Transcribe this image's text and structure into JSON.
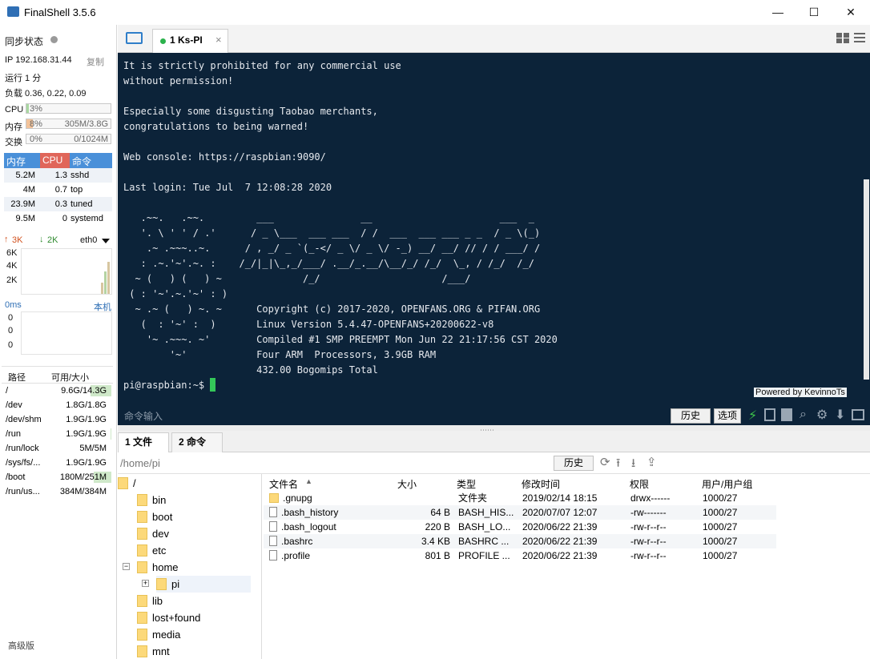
{
  "window": {
    "title": "FinalShell 3.5.6",
    "controls": {
      "minimize": "—",
      "maximize": "☐",
      "close": "✕"
    }
  },
  "left_panel": {
    "sync_label": "同步状态",
    "ip_label": "IP 192.168.31.44",
    "copy_label": "复制",
    "uptime": "运行 1 分",
    "load": "负载 0.36, 0.22, 0.09",
    "cpu": {
      "label": "CPU",
      "percent_text": "3%",
      "fraction": 0.03
    },
    "mem": {
      "label": "内存",
      "percent_text": "8%",
      "detail": "305M/3.8G",
      "fraction": 0.08
    },
    "swap": {
      "label": "交换",
      "percent_text": "0%",
      "detail": "0/1024M",
      "fraction": 0.0
    },
    "proc_headers": {
      "mem": "内存",
      "cpu": "CPU",
      "cmd": "命令"
    },
    "processes": [
      {
        "mem": "5.2M",
        "cpu": "1.3",
        "cmd": "sshd"
      },
      {
        "mem": "4M",
        "cpu": "0.7",
        "cmd": "top"
      },
      {
        "mem": "23.9M",
        "cpu": "0.3",
        "cmd": "tuned"
      },
      {
        "mem": "9.5M",
        "cpu": "0",
        "cmd": "systemd"
      }
    ],
    "net": {
      "up": "3K",
      "down": "2K",
      "iface": "eth0",
      "scale": [
        "6K",
        "4K",
        "2K"
      ]
    },
    "ping": {
      "label": "0ms",
      "host": "本机",
      "values": [
        "0",
        "0",
        "0"
      ]
    },
    "fs_headers": {
      "path": "路径",
      "avail": "可用/大小"
    },
    "filesystems": [
      {
        "path": "/",
        "avail": "9.6G",
        "size": "14.3G",
        "fraction": 0.33
      },
      {
        "path": "/dev",
        "avail": "1.8G",
        "size": "1.8G",
        "fraction": 0.0
      },
      {
        "path": "/dev/shm",
        "avail": "1.9G",
        "size": "1.9G",
        "fraction": 0.0
      },
      {
        "path": "/run",
        "avail": "1.9G",
        "size": "1.9G",
        "fraction": 0.01
      },
      {
        "path": "/run/lock",
        "avail": "5M",
        "size": "5M",
        "fraction": 0.0
      },
      {
        "path": "/sys/fs/...",
        "avail": "1.9G",
        "size": "1.9G",
        "fraction": 0.0
      },
      {
        "path": "/boot",
        "avail": "180M",
        "size": "251M",
        "fraction": 0.28
      },
      {
        "path": "/run/us...",
        "avail": "384M",
        "size": "384M",
        "fraction": 0.0
      }
    ],
    "edition": "高级版"
  },
  "session": {
    "tab_label": "1 Ks-PI",
    "close": "×"
  },
  "terminal": {
    "text": "It is strictly prohibited for any commercial use\nwithout permission!\n\nEspecially some disgusting Taobao merchants,\ncongratulations to being warned!\n\nWeb console: https://raspbian:9090/\n\nLast login: Tue Jul  7 12:08:28 2020\n\n   .~~.   .~~.         ___               __                      ___  _\n   '. \\ ' ' / .'      / _ \\___  ___ ___  / /  ___  ___ ___ _ _  / _ \\(_)\n    .~ .~~~..~.      / , _/ _ `(_-</ _ \\/ _ \\/ -_) __/ __/ // / / ___/ /\n   : .~.'~'.~. :    /_/|_|\\_,_/___/ .__/_.__/\\__/_/ /_/  \\_, / /_/  /_/\n  ~ (   ) (   ) ~              /_/                     /___/\n ( : '~'.~.'~' : )\n  ~ .~ (   ) ~. ~      Copyright (c) 2017-2020, OPENFANS.ORG & PIFAN.ORG\n   (  : '~' :  )       Linux Version 5.4.47-OPENFANS+20200622-v8\n    '~ .~~~. ~'        Compiled #1 SMP PREEMPT Mon Jun 22 21:17:56 CST 2020\n        '~'            Four ARM  Processors, 3.9GB RAM\n                       432.00 Bogomips Total\n",
    "prompt": "pi@raspbian:~$ ",
    "powered_by": "Powered by KevinnoTs",
    "input_placeholder": "命令输入",
    "history_btn": "历史",
    "options_btn": "选项"
  },
  "bottom_tabs": [
    {
      "label": "1 文件"
    },
    {
      "label": "2 命令"
    }
  ],
  "path_bar": {
    "path": "/home/pi",
    "history_btn": "历史"
  },
  "tree": [
    {
      "label": "/",
      "level": 0
    },
    {
      "label": "bin",
      "level": 1
    },
    {
      "label": "boot",
      "level": 1
    },
    {
      "label": "dev",
      "level": 1
    },
    {
      "label": "etc",
      "level": 1
    },
    {
      "label": "home",
      "level": 1
    },
    {
      "label": "pi",
      "level": 2
    },
    {
      "label": "lib",
      "level": 1
    },
    {
      "label": "lost+found",
      "level": 1
    },
    {
      "label": "media",
      "level": 1
    },
    {
      "label": "mnt",
      "level": 1
    }
  ],
  "file_headers": {
    "name": "文件名",
    "size": "大小",
    "type": "类型",
    "mtime": "修改时间",
    "perm": "权限",
    "owner": "用户/用户组"
  },
  "files": [
    {
      "name": ".gnupg",
      "size": "",
      "type": "文件夹",
      "mtime": "2019/02/14 18:15",
      "perm": "drwx------",
      "owner": "1000/27",
      "is_dir": true
    },
    {
      "name": ".bash_history",
      "size": "64 B",
      "type": "BASH_HIS...",
      "mtime": "2020/07/07 12:07",
      "perm": "-rw-------",
      "owner": "1000/27",
      "is_dir": false
    },
    {
      "name": ".bash_logout",
      "size": "220 B",
      "type": "BASH_LO...",
      "mtime": "2020/06/22 21:39",
      "perm": "-rw-r--r--",
      "owner": "1000/27",
      "is_dir": false
    },
    {
      "name": ".bashrc",
      "size": "3.4 KB",
      "type": "BASHRC ...",
      "mtime": "2020/06/22 21:39",
      "perm": "-rw-r--r--",
      "owner": "1000/27",
      "is_dir": false
    },
    {
      "name": ".profile",
      "size": "801 B",
      "type": "PROFILE ...",
      "mtime": "2020/06/22 21:39",
      "perm": "-rw-r--r--",
      "owner": "1000/27",
      "is_dir": false
    }
  ],
  "colors": {
    "terminal_bg": "#0c2339",
    "accent_blue": "#4a90d9",
    "cpu_header": "#e0665a",
    "cursor": "#34c759"
  }
}
